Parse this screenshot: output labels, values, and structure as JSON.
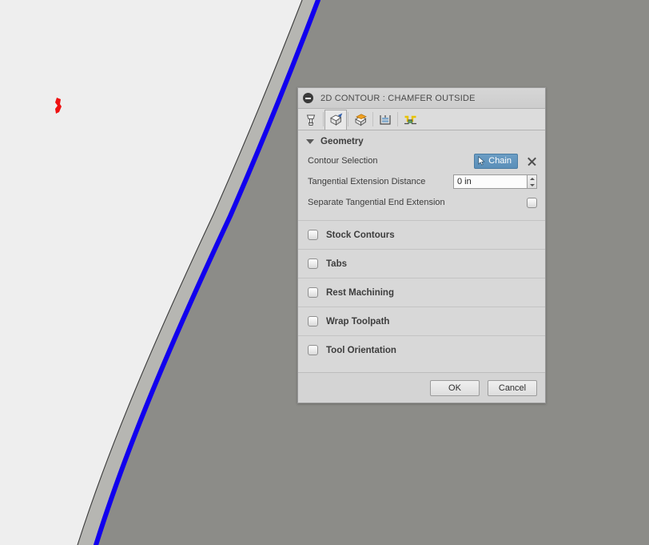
{
  "viewport": {
    "name": "cad-3d-viewport",
    "background_color": "#eeeeee",
    "body_color": "#8c8c88",
    "chamfer_band_color": "#b6b6b2",
    "outline_color": "#3a3a3a",
    "highlight_edge_color": "#1100ee",
    "marker_color": "#ee1111",
    "marker_label": "origin-marker"
  },
  "dialog": {
    "title": "2D CONTOUR : CHAMFER OUTSIDE",
    "collapse_icon": "minus-circle-icon",
    "tabs": [
      {
        "id": "tool",
        "icon": "end-mill-tool-icon",
        "label": "Tool",
        "active": false
      },
      {
        "id": "geometry",
        "icon": "geometry-cube-icon",
        "label": "Geometry",
        "active": true
      },
      {
        "id": "heights",
        "icon": "heights-cube-icon",
        "label": "Heights",
        "active": false
      },
      {
        "id": "passes",
        "icon": "passes-icon",
        "label": "Passes",
        "active": false
      },
      {
        "id": "linking",
        "icon": "linking-icon",
        "label": "Linking",
        "active": false
      }
    ],
    "geometry": {
      "section_label": "Geometry",
      "expanded": true,
      "expander_icon": "triangle-down-icon",
      "contour_selection": {
        "label": "Contour Selection",
        "button_label": "Chain",
        "button_icon": "cursor-arrow-icon",
        "button_color": "#5b8fb9",
        "clear_icon": "close-x-icon"
      },
      "tangential_extension_distance": {
        "label": "Tangential Extension Distance",
        "value": "0 in",
        "spinner_up_icon": "triangle-up-icon",
        "spinner_down_icon": "triangle-down-icon"
      },
      "separate_tangential_end_extension": {
        "label": "Separate Tangential End Extension",
        "checked": false
      }
    },
    "collapsed_sections": [
      {
        "label": "Stock Contours",
        "checked": false
      },
      {
        "label": "Tabs",
        "checked": false
      },
      {
        "label": "Rest Machining",
        "checked": false
      },
      {
        "label": "Wrap Toolpath",
        "checked": false
      },
      {
        "label": "Tool Orientation",
        "checked": false
      }
    ],
    "footer": {
      "ok_label": "OK",
      "cancel_label": "Cancel"
    }
  }
}
